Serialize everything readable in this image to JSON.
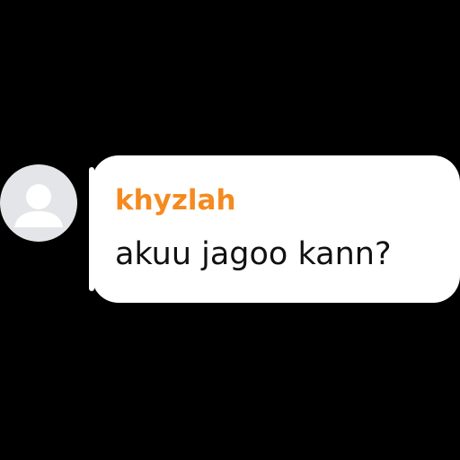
{
  "comment": {
    "sender_name": "khyzlah",
    "message_text": "akuu jagoo kann?",
    "avatar_icon": "default-user-avatar-icon"
  },
  "colors": {
    "background": "#000000",
    "bubble": "#ffffff",
    "sender_name": "#f58a1f",
    "message_text": "#111111",
    "avatar_bg": "#e3e5e8",
    "avatar_glyph": "#ffffff"
  }
}
